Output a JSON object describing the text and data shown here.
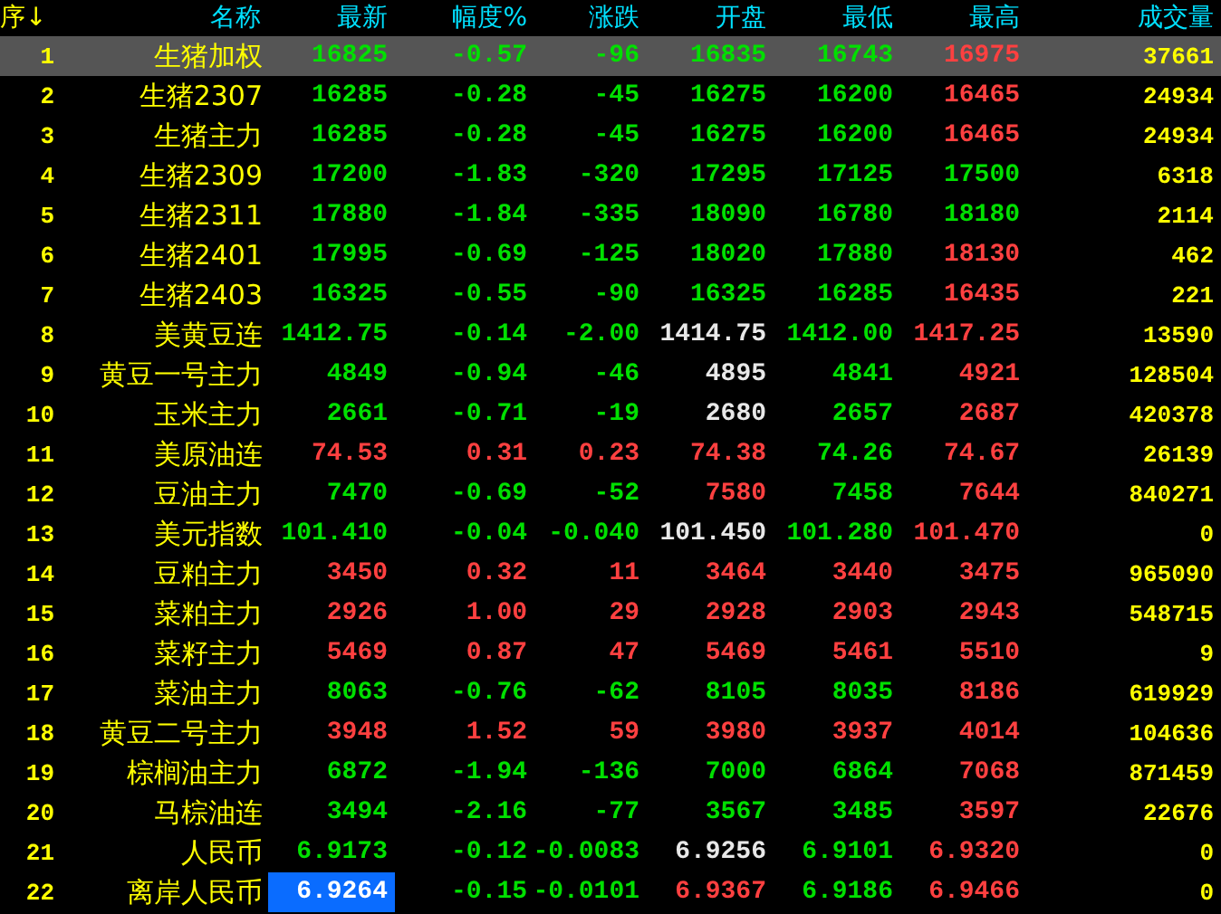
{
  "table": {
    "columns": [
      {
        "label": "序↓"
      },
      {
        "label": "名称"
      },
      {
        "label": "最新"
      },
      {
        "label": "幅度%"
      },
      {
        "label": "涨跌"
      },
      {
        "label": "开盘"
      },
      {
        "label": "最低"
      },
      {
        "label": "最高"
      },
      {
        "label": "成交量"
      }
    ],
    "rows": [
      {
        "seq": "1",
        "name": "生猪加权",
        "selected": true,
        "cursor": false,
        "quotes": [
          {
            "text": "16825",
            "color": "#00e000"
          },
          {
            "text": "-0.57",
            "color": "#00e000"
          },
          {
            "text": "-96",
            "color": "#00e000"
          },
          {
            "text": "16835",
            "color": "#00e000"
          },
          {
            "text": "16743",
            "color": "#00e000"
          },
          {
            "text": "16975",
            "color": "#ff4040"
          }
        ],
        "volume": "37661"
      },
      {
        "seq": "2",
        "name": "生猪2307",
        "selected": false,
        "cursor": false,
        "quotes": [
          {
            "text": "16285",
            "color": "#00e000"
          },
          {
            "text": "-0.28",
            "color": "#00e000"
          },
          {
            "text": "-45",
            "color": "#00e000"
          },
          {
            "text": "16275",
            "color": "#00e000"
          },
          {
            "text": "16200",
            "color": "#00e000"
          },
          {
            "text": "16465",
            "color": "#ff4040"
          }
        ],
        "volume": "24934"
      },
      {
        "seq": "3",
        "name": "生猪主力",
        "selected": false,
        "cursor": false,
        "quotes": [
          {
            "text": "16285",
            "color": "#00e000"
          },
          {
            "text": "-0.28",
            "color": "#00e000"
          },
          {
            "text": "-45",
            "color": "#00e000"
          },
          {
            "text": "16275",
            "color": "#00e000"
          },
          {
            "text": "16200",
            "color": "#00e000"
          },
          {
            "text": "16465",
            "color": "#ff4040"
          }
        ],
        "volume": "24934"
      },
      {
        "seq": "4",
        "name": "生猪2309",
        "selected": false,
        "cursor": false,
        "quotes": [
          {
            "text": "17200",
            "color": "#00e000"
          },
          {
            "text": "-1.83",
            "color": "#00e000"
          },
          {
            "text": "-320",
            "color": "#00e000"
          },
          {
            "text": "17295",
            "color": "#00e000"
          },
          {
            "text": "17125",
            "color": "#00e000"
          },
          {
            "text": "17500",
            "color": "#00e000"
          }
        ],
        "volume": "6318"
      },
      {
        "seq": "5",
        "name": "生猪2311",
        "selected": false,
        "cursor": false,
        "quotes": [
          {
            "text": "17880",
            "color": "#00e000"
          },
          {
            "text": "-1.84",
            "color": "#00e000"
          },
          {
            "text": "-335",
            "color": "#00e000"
          },
          {
            "text": "18090",
            "color": "#00e000"
          },
          {
            "text": "16780",
            "color": "#00e000"
          },
          {
            "text": "18180",
            "color": "#00e000"
          }
        ],
        "volume": "2114"
      },
      {
        "seq": "6",
        "name": "生猪2401",
        "selected": false,
        "cursor": false,
        "quotes": [
          {
            "text": "17995",
            "color": "#00e000"
          },
          {
            "text": "-0.69",
            "color": "#00e000"
          },
          {
            "text": "-125",
            "color": "#00e000"
          },
          {
            "text": "18020",
            "color": "#00e000"
          },
          {
            "text": "17880",
            "color": "#00e000"
          },
          {
            "text": "18130",
            "color": "#ff4040"
          }
        ],
        "volume": "462"
      },
      {
        "seq": "7",
        "name": "生猪2403",
        "selected": false,
        "cursor": false,
        "quotes": [
          {
            "text": "16325",
            "color": "#00e000"
          },
          {
            "text": "-0.55",
            "color": "#00e000"
          },
          {
            "text": "-90",
            "color": "#00e000"
          },
          {
            "text": "16325",
            "color": "#00e000"
          },
          {
            "text": "16285",
            "color": "#00e000"
          },
          {
            "text": "16435",
            "color": "#ff4040"
          }
        ],
        "volume": "221"
      },
      {
        "seq": "8",
        "name": "美黄豆连",
        "selected": false,
        "cursor": false,
        "quotes": [
          {
            "text": "1412.75",
            "color": "#00e000"
          },
          {
            "text": "-0.14",
            "color": "#00e000"
          },
          {
            "text": "-2.00",
            "color": "#00e000"
          },
          {
            "text": "1414.75",
            "color": "#e8e8e8"
          },
          {
            "text": "1412.00",
            "color": "#00e000"
          },
          {
            "text": "1417.25",
            "color": "#ff4040"
          }
        ],
        "volume": "13590"
      },
      {
        "seq": "9",
        "name": "黄豆一号主力",
        "selected": false,
        "cursor": false,
        "quotes": [
          {
            "text": "4849",
            "color": "#00e000"
          },
          {
            "text": "-0.94",
            "color": "#00e000"
          },
          {
            "text": "-46",
            "color": "#00e000"
          },
          {
            "text": "4895",
            "color": "#e8e8e8"
          },
          {
            "text": "4841",
            "color": "#00e000"
          },
          {
            "text": "4921",
            "color": "#ff4040"
          }
        ],
        "volume": "128504"
      },
      {
        "seq": "10",
        "name": "玉米主力",
        "selected": false,
        "cursor": false,
        "quotes": [
          {
            "text": "2661",
            "color": "#00e000"
          },
          {
            "text": "-0.71",
            "color": "#00e000"
          },
          {
            "text": "-19",
            "color": "#00e000"
          },
          {
            "text": "2680",
            "color": "#e8e8e8"
          },
          {
            "text": "2657",
            "color": "#00e000"
          },
          {
            "text": "2687",
            "color": "#ff4040"
          }
        ],
        "volume": "420378"
      },
      {
        "seq": "11",
        "name": "美原油连",
        "selected": false,
        "cursor": false,
        "quotes": [
          {
            "text": "74.53",
            "color": "#ff4040"
          },
          {
            "text": "0.31",
            "color": "#ff4040"
          },
          {
            "text": "0.23",
            "color": "#ff4040"
          },
          {
            "text": "74.38",
            "color": "#ff4040"
          },
          {
            "text": "74.26",
            "color": "#00e000"
          },
          {
            "text": "74.67",
            "color": "#ff4040"
          }
        ],
        "volume": "26139"
      },
      {
        "seq": "12",
        "name": "豆油主力",
        "selected": false,
        "cursor": false,
        "quotes": [
          {
            "text": "7470",
            "color": "#00e000"
          },
          {
            "text": "-0.69",
            "color": "#00e000"
          },
          {
            "text": "-52",
            "color": "#00e000"
          },
          {
            "text": "7580",
            "color": "#ff4040"
          },
          {
            "text": "7458",
            "color": "#00e000"
          },
          {
            "text": "7644",
            "color": "#ff4040"
          }
        ],
        "volume": "840271"
      },
      {
        "seq": "13",
        "name": "美元指数",
        "selected": false,
        "cursor": false,
        "quotes": [
          {
            "text": "101.410",
            "color": "#00e000"
          },
          {
            "text": "-0.04",
            "color": "#00e000"
          },
          {
            "text": "-0.040",
            "color": "#00e000"
          },
          {
            "text": "101.450",
            "color": "#e8e8e8"
          },
          {
            "text": "101.280",
            "color": "#00e000"
          },
          {
            "text": "101.470",
            "color": "#ff4040"
          }
        ],
        "volume": "0"
      },
      {
        "seq": "14",
        "name": "豆粕主力",
        "selected": false,
        "cursor": false,
        "quotes": [
          {
            "text": "3450",
            "color": "#ff4040"
          },
          {
            "text": "0.32",
            "color": "#ff4040"
          },
          {
            "text": "11",
            "color": "#ff4040"
          },
          {
            "text": "3464",
            "color": "#ff4040"
          },
          {
            "text": "3440",
            "color": "#ff4040"
          },
          {
            "text": "3475",
            "color": "#ff4040"
          }
        ],
        "volume": "965090"
      },
      {
        "seq": "15",
        "name": "菜粕主力",
        "selected": false,
        "cursor": false,
        "quotes": [
          {
            "text": "2926",
            "color": "#ff4040"
          },
          {
            "text": "1.00",
            "color": "#ff4040"
          },
          {
            "text": "29",
            "color": "#ff4040"
          },
          {
            "text": "2928",
            "color": "#ff4040"
          },
          {
            "text": "2903",
            "color": "#ff4040"
          },
          {
            "text": "2943",
            "color": "#ff4040"
          }
        ],
        "volume": "548715"
      },
      {
        "seq": "16",
        "name": "菜籽主力",
        "selected": false,
        "cursor": false,
        "quotes": [
          {
            "text": "5469",
            "color": "#ff4040"
          },
          {
            "text": "0.87",
            "color": "#ff4040"
          },
          {
            "text": "47",
            "color": "#ff4040"
          },
          {
            "text": "5469",
            "color": "#ff4040"
          },
          {
            "text": "5461",
            "color": "#ff4040"
          },
          {
            "text": "5510",
            "color": "#ff4040"
          }
        ],
        "volume": "9"
      },
      {
        "seq": "17",
        "name": "菜油主力",
        "selected": false,
        "cursor": false,
        "quotes": [
          {
            "text": "8063",
            "color": "#00e000"
          },
          {
            "text": "-0.76",
            "color": "#00e000"
          },
          {
            "text": "-62",
            "color": "#00e000"
          },
          {
            "text": "8105",
            "color": "#00e000"
          },
          {
            "text": "8035",
            "color": "#00e000"
          },
          {
            "text": "8186",
            "color": "#ff4040"
          }
        ],
        "volume": "619929"
      },
      {
        "seq": "18",
        "name": "黄豆二号主力",
        "selected": false,
        "cursor": false,
        "quotes": [
          {
            "text": "3948",
            "color": "#ff4040"
          },
          {
            "text": "1.52",
            "color": "#ff4040"
          },
          {
            "text": "59",
            "color": "#ff4040"
          },
          {
            "text": "3980",
            "color": "#ff4040"
          },
          {
            "text": "3937",
            "color": "#ff4040"
          },
          {
            "text": "4014",
            "color": "#ff4040"
          }
        ],
        "volume": "104636"
      },
      {
        "seq": "19",
        "name": "棕榈油主力",
        "selected": false,
        "cursor": false,
        "quotes": [
          {
            "text": "6872",
            "color": "#00e000"
          },
          {
            "text": "-1.94",
            "color": "#00e000"
          },
          {
            "text": "-136",
            "color": "#00e000"
          },
          {
            "text": "7000",
            "color": "#00e000"
          },
          {
            "text": "6864",
            "color": "#00e000"
          },
          {
            "text": "7068",
            "color": "#ff4040"
          }
        ],
        "volume": "871459"
      },
      {
        "seq": "20",
        "name": "马棕油连",
        "selected": false,
        "cursor": false,
        "quotes": [
          {
            "text": "3494",
            "color": "#00e000"
          },
          {
            "text": "-2.16",
            "color": "#00e000"
          },
          {
            "text": "-77",
            "color": "#00e000"
          },
          {
            "text": "3567",
            "color": "#00e000"
          },
          {
            "text": "3485",
            "color": "#00e000"
          },
          {
            "text": "3597",
            "color": "#ff4040"
          }
        ],
        "volume": "22676"
      },
      {
        "seq": "21",
        "name": "人民币",
        "selected": false,
        "cursor": false,
        "quotes": [
          {
            "text": "6.9173",
            "color": "#00e000"
          },
          {
            "text": "-0.12",
            "color": "#00e000"
          },
          {
            "text": "-0.0083",
            "color": "#00e000"
          },
          {
            "text": "6.9256",
            "color": "#e8e8e8"
          },
          {
            "text": "6.9101",
            "color": "#00e000"
          },
          {
            "text": "6.9320",
            "color": "#ff4040"
          }
        ],
        "volume": "0"
      },
      {
        "seq": "22",
        "name": "离岸人民币",
        "selected": false,
        "cursor": true,
        "quotes": [
          {
            "text": "6.9264",
            "color": "#ffffff"
          },
          {
            "text": "-0.15",
            "color": "#00e000"
          },
          {
            "text": "-0.0101",
            "color": "#00e000"
          },
          {
            "text": "6.9367",
            "color": "#ff4040"
          },
          {
            "text": "6.9186",
            "color": "#00e000"
          },
          {
            "text": "6.9466",
            "color": "#ff4040"
          }
        ],
        "volume": "0"
      }
    ]
  }
}
